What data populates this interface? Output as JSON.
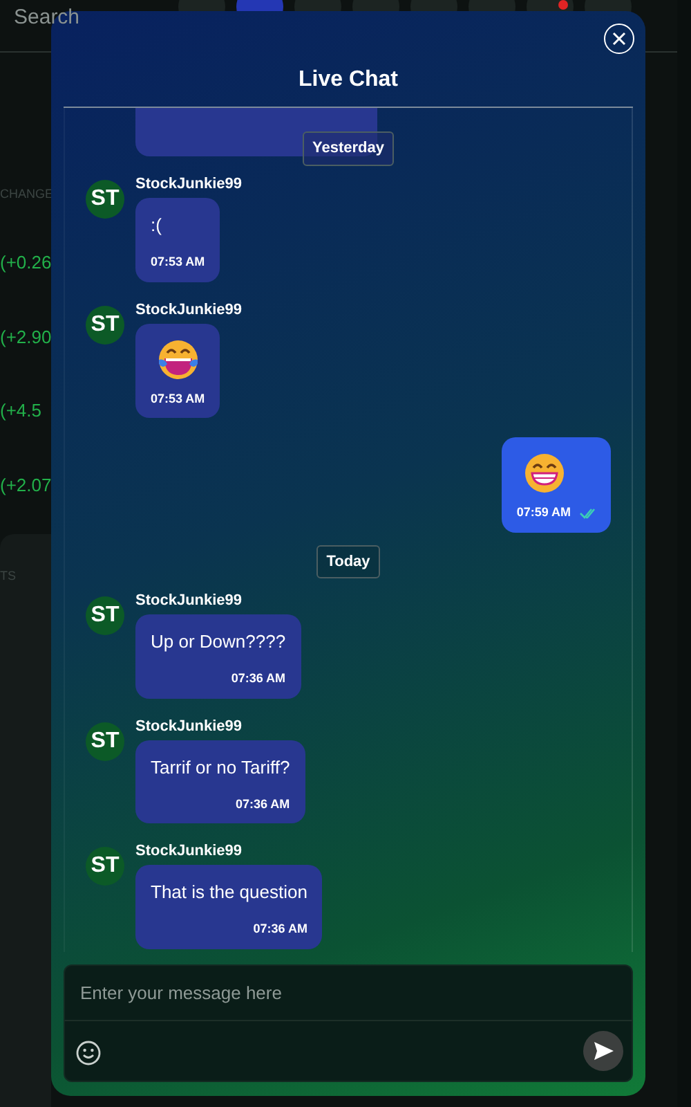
{
  "background": {
    "search": {
      "placeholder": "Search"
    },
    "toolbar": [
      {
        "selected": false
      },
      {
        "selected": true
      },
      {
        "selected": false
      },
      {
        "selected": false
      },
      {
        "selected": false
      },
      {
        "selected": false
      },
      {
        "selected": false,
        "alert": true
      },
      {
        "selected": false
      }
    ],
    "column_header": "CHANGE",
    "changes": [
      "(+0.26",
      "(+2.90",
      "(+4.5",
      "(+2.07"
    ],
    "tab": "TS"
  },
  "chat": {
    "title": "Live Chat",
    "items": [
      {
        "kind": "text",
        "outgoing": false,
        "partial": true
      },
      {
        "kind": "divider",
        "label": "Yesterday",
        "sticky": true
      },
      {
        "kind": "text",
        "outgoing": false,
        "avatar": "ST",
        "sender": "StockJunkie99",
        "text": ":(",
        "time": "07:53 AM"
      },
      {
        "kind": "laugh",
        "outgoing": false,
        "avatar": "ST",
        "sender": "StockJunkie99",
        "time": "07:53 AM"
      },
      {
        "kind": "grin",
        "outgoing": true,
        "time": "07:59 AM",
        "read": true
      },
      {
        "kind": "divider",
        "label": "Today",
        "sticky": false
      },
      {
        "kind": "text",
        "outgoing": false,
        "avatar": "ST",
        "sender": "StockJunkie99",
        "text": "Up or Down????",
        "time": "07:36 AM"
      },
      {
        "kind": "text",
        "outgoing": false,
        "avatar": "ST",
        "sender": "StockJunkie99",
        "text": "Tarrif or no Tariff?",
        "time": "07:36 AM"
      },
      {
        "kind": "text",
        "outgoing": false,
        "avatar": "ST",
        "sender": "StockJunkie99",
        "text": "That is the question",
        "time": "07:36 AM"
      }
    ],
    "composer": {
      "placeholder": "Enter your message here"
    }
  }
}
